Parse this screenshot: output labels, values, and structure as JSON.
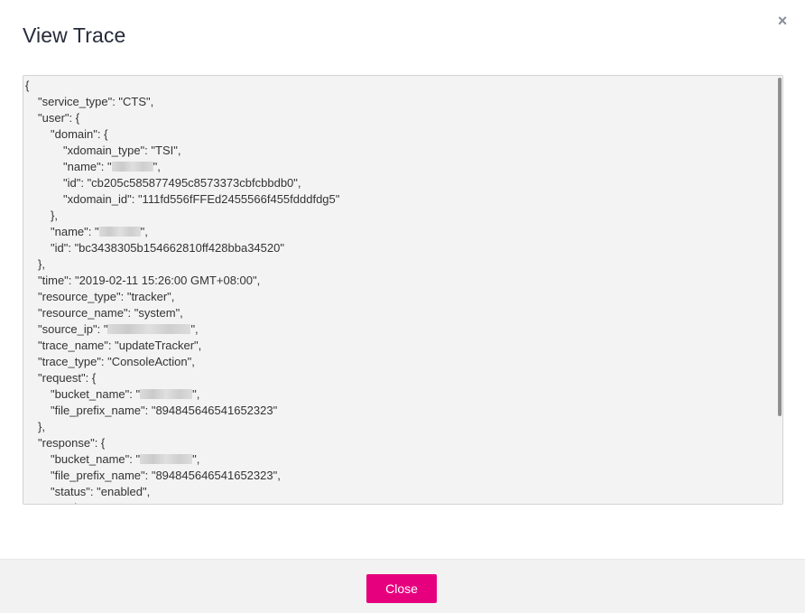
{
  "dialog": {
    "title": "View Trace",
    "close_icon": "close-icon",
    "close_glyph": "×"
  },
  "trace": {
    "lines": [
      {
        "indent": 0,
        "parts": [
          {
            "t": "{"
          }
        ]
      },
      {
        "indent": 1,
        "parts": [
          {
            "t": "\"service_type\": \"CTS\","
          }
        ]
      },
      {
        "indent": 1,
        "parts": [
          {
            "t": "\"user\": {"
          }
        ]
      },
      {
        "indent": 2,
        "parts": [
          {
            "t": "\"domain\": {"
          }
        ]
      },
      {
        "indent": 3,
        "parts": [
          {
            "t": "\"xdomain_type\": \"TSI\","
          }
        ]
      },
      {
        "indent": 3,
        "parts": [
          {
            "t": "\"name\": \""
          },
          {
            "mask": 46
          },
          {
            "t": "\","
          }
        ]
      },
      {
        "indent": 3,
        "parts": [
          {
            "t": "\"id\": \"cb205c585877495c8573373cbfcbbdb0\","
          }
        ]
      },
      {
        "indent": 3,
        "parts": [
          {
            "t": "\"xdomain_id\": \"111fd556fFFEd2455566f455fdddfdg5\""
          }
        ]
      },
      {
        "indent": 2,
        "parts": [
          {
            "t": "},"
          }
        ]
      },
      {
        "indent": 2,
        "parts": [
          {
            "t": "\"name\": \""
          },
          {
            "mask": 46
          },
          {
            "t": "\","
          }
        ]
      },
      {
        "indent": 2,
        "parts": [
          {
            "t": "\"id\": \"bc3438305b154662810ff428bba34520\""
          }
        ]
      },
      {
        "indent": 1,
        "parts": [
          {
            "t": "},"
          }
        ]
      },
      {
        "indent": 1,
        "parts": [
          {
            "t": "\"time\": \"2019-02-11 15:26:00 GMT+08:00\","
          }
        ]
      },
      {
        "indent": 1,
        "parts": [
          {
            "t": "\"resource_type\": \"tracker\","
          }
        ]
      },
      {
        "indent": 1,
        "parts": [
          {
            "t": "\"resource_name\": \"system\","
          }
        ]
      },
      {
        "indent": 1,
        "parts": [
          {
            "t": "\"source_ip\": \""
          },
          {
            "mask": 92
          },
          {
            "t": "\","
          }
        ]
      },
      {
        "indent": 1,
        "parts": [
          {
            "t": "\"trace_name\": \"updateTracker\","
          }
        ]
      },
      {
        "indent": 1,
        "parts": [
          {
            "t": "\"trace_type\": \"ConsoleAction\","
          }
        ]
      },
      {
        "indent": 1,
        "parts": [
          {
            "t": "\"request\": {"
          }
        ]
      },
      {
        "indent": 2,
        "parts": [
          {
            "t": "\"bucket_name\": \""
          },
          {
            "mask": 58
          },
          {
            "t": "\","
          }
        ]
      },
      {
        "indent": 2,
        "parts": [
          {
            "t": "\"file_prefix_name\": \"894845646541652323\""
          }
        ]
      },
      {
        "indent": 1,
        "parts": [
          {
            "t": "},"
          }
        ]
      },
      {
        "indent": 1,
        "parts": [
          {
            "t": "\"response\": {"
          }
        ]
      },
      {
        "indent": 2,
        "parts": [
          {
            "t": "\"bucket_name\": \""
          },
          {
            "mask": 58
          },
          {
            "t": "\","
          }
        ]
      },
      {
        "indent": 2,
        "parts": [
          {
            "t": "\"file_prefix_name\": \"894845646541652323\","
          }
        ]
      },
      {
        "indent": 2,
        "parts": [
          {
            "t": "\"status\": \"enabled\","
          }
        ]
      },
      {
        "indent": 2,
        "parts": [
          {
            "t": "\"tracker_name\": \"system\""
          }
        ]
      }
    ]
  },
  "footer": {
    "close_label": "Close"
  },
  "colors": {
    "accent": "#e6007e",
    "text": "#333333",
    "box_bg": "#f3f3f3",
    "footer_bg": "#f2f2f2"
  }
}
